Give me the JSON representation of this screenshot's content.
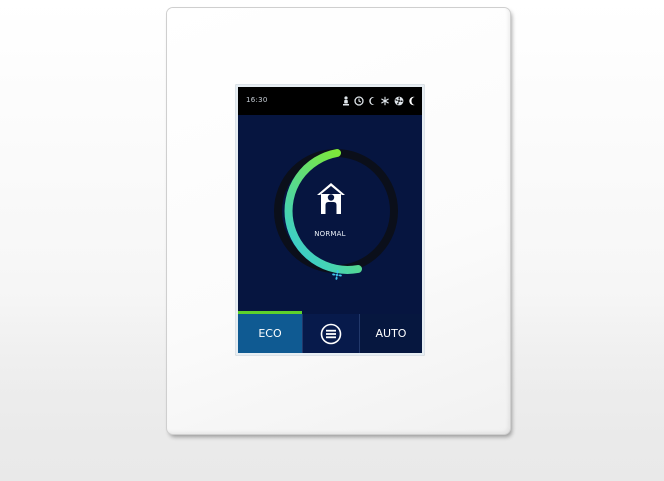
{
  "status_bar": {
    "time": "16:30",
    "icons": [
      "occupancy-icon",
      "clock-icon",
      "moon-icon",
      "snowflake-icon",
      "fan-icon",
      "crescent-icon"
    ]
  },
  "main": {
    "mode_label": "NORMAL",
    "center_icon": "home-person-icon",
    "fan_indicator_icon": "fan-icon"
  },
  "tabs": [
    {
      "label": "ECO",
      "active": true
    },
    {
      "label": "",
      "icon": "menu-icon"
    },
    {
      "label": "AUTO"
    }
  ],
  "colors": {
    "screen_bg": "#061540",
    "active_tab": "#0f5a92",
    "indicator_green": "#5ed22b",
    "ring_start": "#2fc9e6",
    "ring_end": "#7de83a"
  }
}
